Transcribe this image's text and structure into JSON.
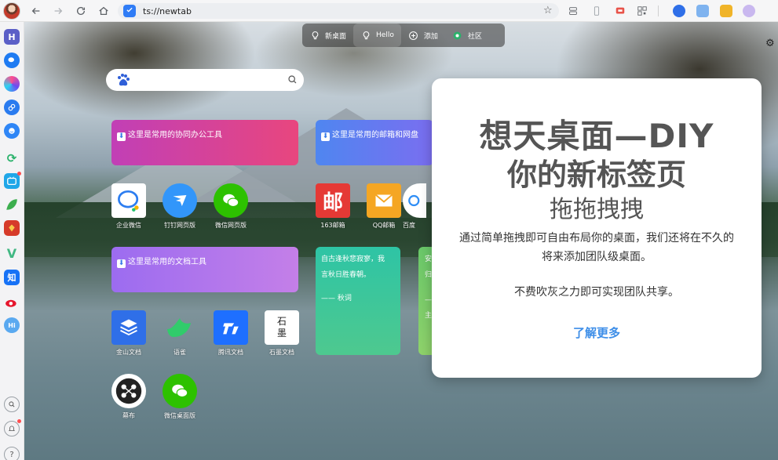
{
  "browser": {
    "url": "ts://newtab",
    "toolbar_icons": [
      "back-arrow-icon",
      "forward-arrow-icon",
      "reload-icon",
      "home-icon",
      "star-icon"
    ]
  },
  "sidebar": {
    "items": [
      {
        "name": "sidebar-item-hb",
        "label": "H",
        "color": "#5b5fc7"
      },
      {
        "name": "sidebar-item-wechat",
        "label": "",
        "color": "#1f7bf2"
      },
      {
        "name": "sidebar-item-circle",
        "label": "",
        "color": "#6a4df2"
      },
      {
        "name": "sidebar-item-link",
        "label": "",
        "color": "#2a7bef"
      },
      {
        "name": "sidebar-item-smile",
        "label": "",
        "color": "#2f86f6"
      },
      {
        "name": "sidebar-item-sync",
        "label": "",
        "color": "#2ab26b"
      },
      {
        "name": "sidebar-item-bilibili",
        "label": "",
        "color": "#20a7e8"
      },
      {
        "name": "sidebar-item-leaf",
        "label": "",
        "color": "#3cae4e"
      },
      {
        "name": "sidebar-item-game",
        "label": "",
        "color": "#d63b2a"
      },
      {
        "name": "sidebar-item-vue",
        "label": "V",
        "color": "#41b883"
      },
      {
        "name": "sidebar-item-zhihu",
        "label": "知",
        "color": "#1772f6"
      },
      {
        "name": "sidebar-item-weibo",
        "label": "",
        "color": "#e6162d"
      },
      {
        "name": "sidebar-item-hi",
        "label": "Hi",
        "color": "#5aa9f0"
      }
    ]
  },
  "topmenu": {
    "items": [
      {
        "label": "新桌面"
      },
      {
        "label": "Hello"
      },
      {
        "label": "添加"
      },
      {
        "label": "社区"
      }
    ]
  },
  "groups": {
    "office": "这里是常用的协同办公工具",
    "mail": "这里是常用的邮箱和网盘",
    "docs": "这里是常用的文档工具"
  },
  "apps": [
    {
      "label": "企业微信"
    },
    {
      "label": "钉钉网页版"
    },
    {
      "label": "微信网页版"
    },
    {
      "label": "163邮箱"
    },
    {
      "label": "QQ邮箱"
    },
    {
      "label": "百度"
    },
    {
      "label": "金山文档"
    },
    {
      "label": "语雀"
    },
    {
      "label": "腾讯文档"
    },
    {
      "label": "石墨文档"
    },
    {
      "label": "幕布"
    },
    {
      "label": "微信桌面版"
    }
  ],
  "shimo_glyph": "石\n墨",
  "mail_163_glyph": "邮",
  "poem": {
    "lines": [
      "自古逢秋悲寂寥，我",
      "言秋日胜春朝。"
    ],
    "author": "—— 秋词",
    "partial": [
      "安",
      "归",
      "",
      "—",
      "主"
    ]
  },
  "modal": {
    "title1": "想天桌面—DIY",
    "title2": "你的新标签页",
    "subtitle": "拖拖拽拽",
    "desc": "通过简单拖拽即可自由布局你的桌面，我们还将在不久的将来添加团队级桌面。",
    "note": "不费吹灰之力即可实现团队共享。",
    "link": "了解更多"
  },
  "colors": {
    "accent": "#3d8ee8",
    "group_office": "#d43f9a",
    "group_docs": "#a56de8",
    "group_mail": "#4f86f0",
    "poem_card": "#2ec4a5"
  }
}
